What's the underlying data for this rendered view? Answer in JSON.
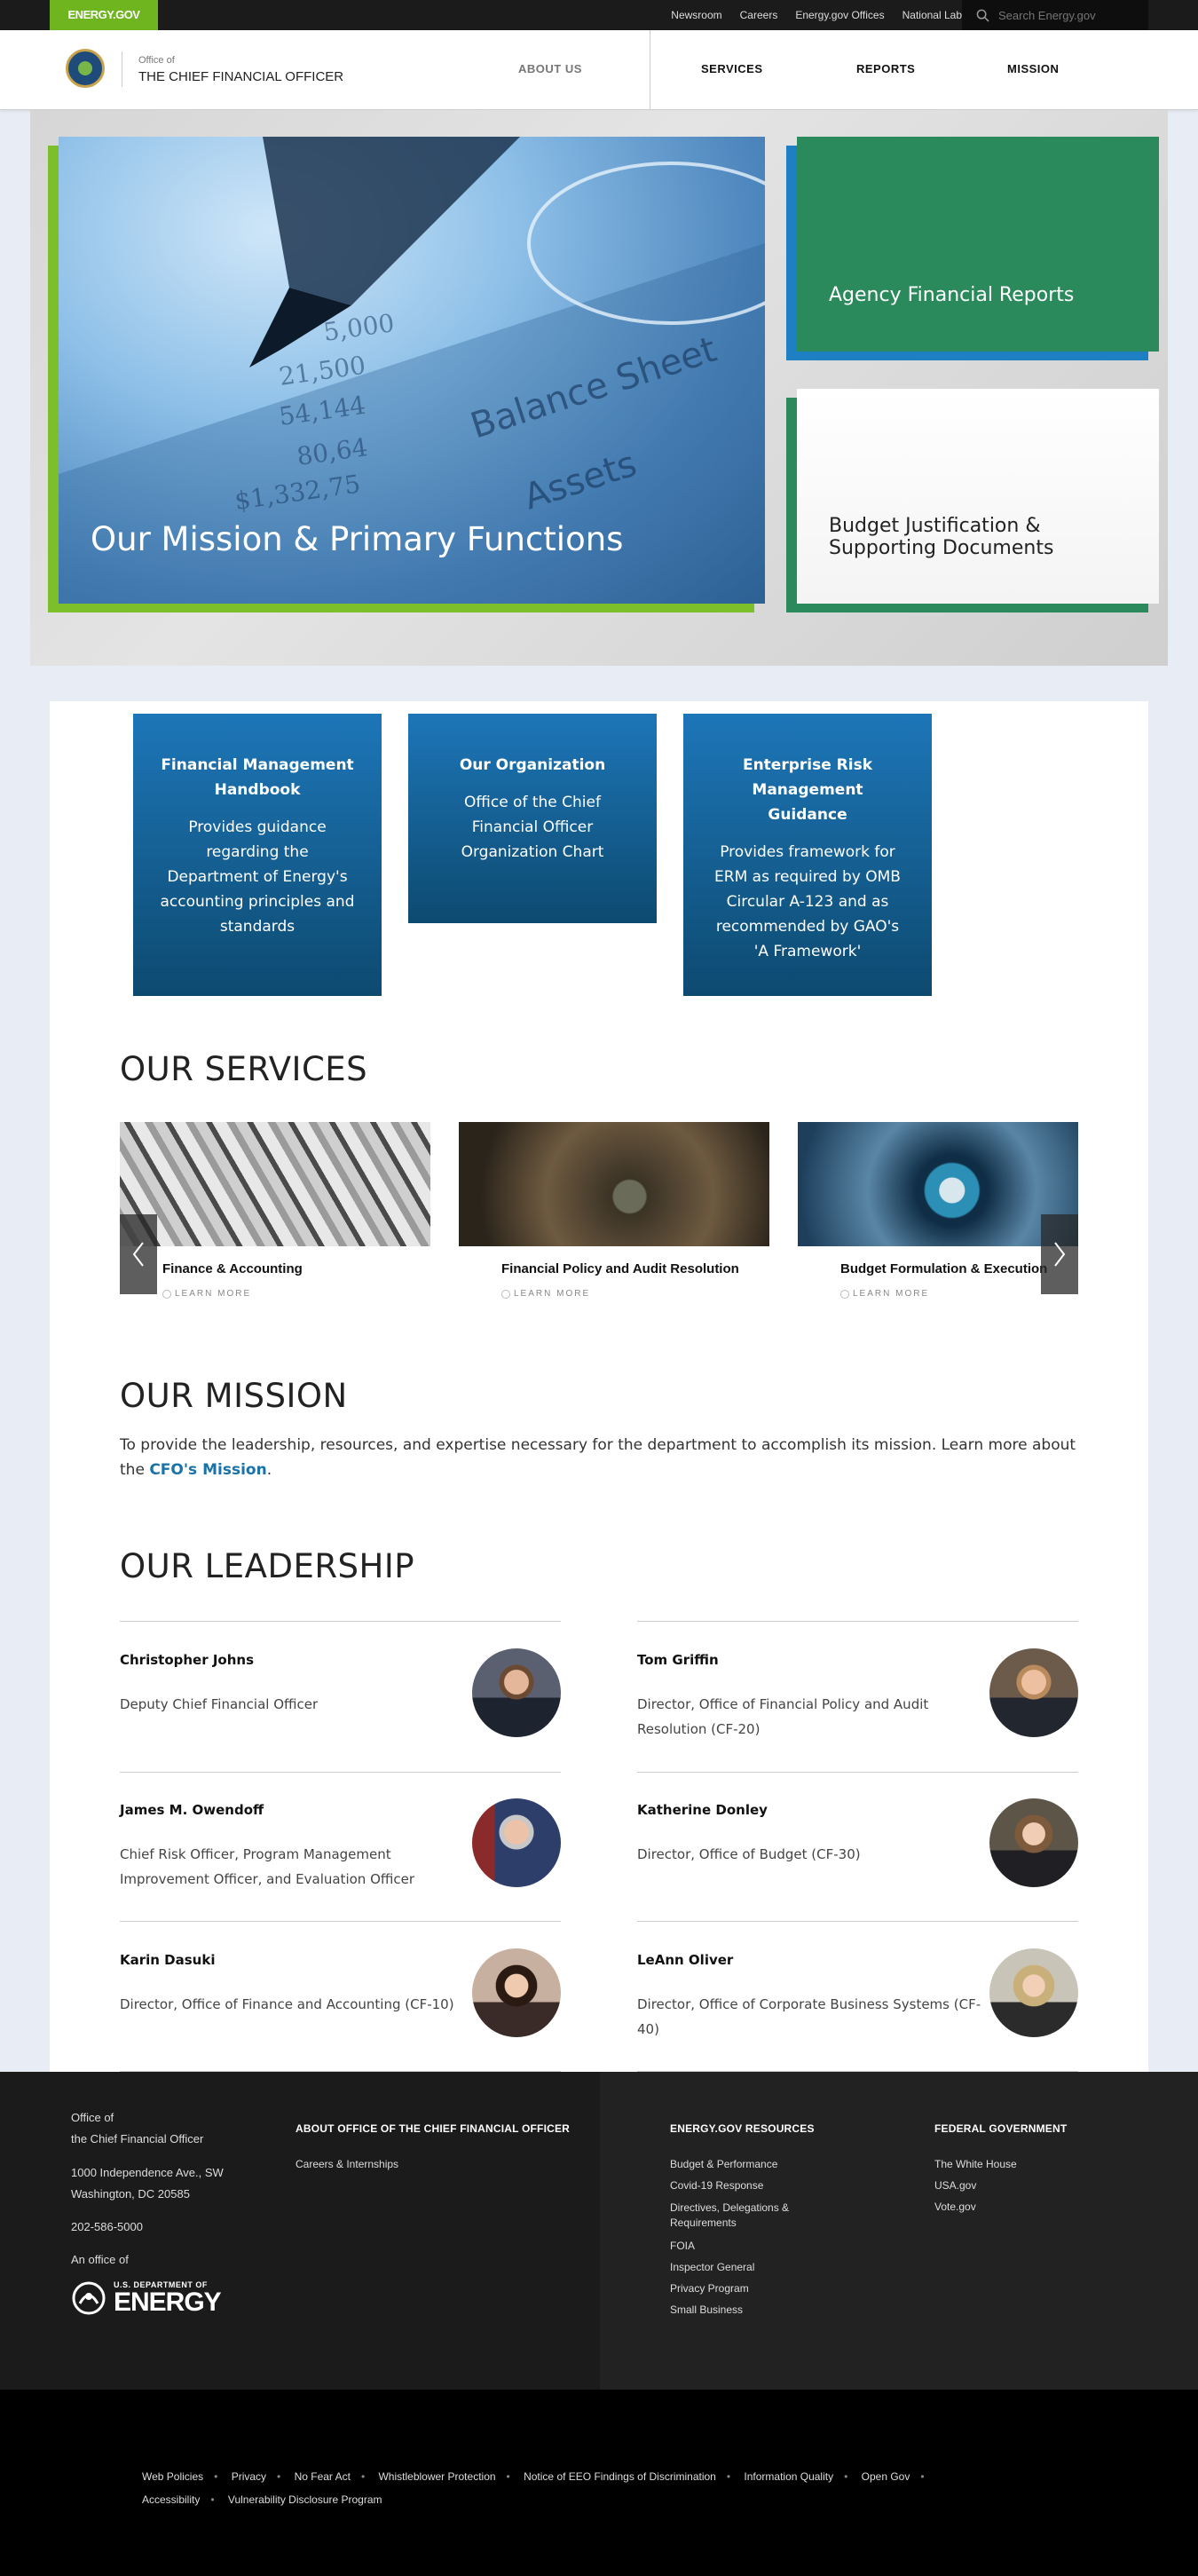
{
  "topbar": {
    "brand": "ENERGY.GOV",
    "links": [
      "Newsroom",
      "Careers",
      "Energy.gov Offices",
      "National Labs"
    ],
    "search_placeholder": "Search Energy.gov"
  },
  "header": {
    "office_of": "Office of",
    "office_name": "THE CHIEF FINANCIAL OFFICER",
    "nav": {
      "about": "ABOUT US",
      "services": "SERVICES",
      "reports": "REPORTS",
      "mission": "MISSION"
    }
  },
  "hero": {
    "main_title": "Our Mission & Primary Functions",
    "card_a": "Agency Financial Reports",
    "card_b": "Budget Justification & Supporting Documents"
  },
  "quick_cards": [
    {
      "title": "Financial Management Handbook",
      "text": "Provides guidance regarding the Department of Energy's accounting principles and standards"
    },
    {
      "title": "Our Organization",
      "text": "Office of the Chief Financial Officer Organization Chart"
    },
    {
      "title": "Enterprise Risk Management Guidance",
      "text": "Provides framework for ERM as required by OMB Circular A-123 and as recommended by GAO's 'A Framework'"
    }
  ],
  "services": {
    "heading": "OUR SERVICES",
    "learn_more": "LEARN MORE",
    "items": [
      {
        "title": "Finance & Accounting"
      },
      {
        "title": "Financial Policy and Audit Resolution"
      },
      {
        "title": "Budget Formulation & Execution"
      }
    ]
  },
  "mission": {
    "heading": "OUR MISSION",
    "text": "To provide the leadership, resources, and expertise necessary for the department to accomplish its mission. Learn more about the",
    "link": "CFO's Mission",
    "link_suffix": "."
  },
  "leadership": {
    "heading": "OUR LEADERSHIP",
    "people": [
      {
        "name": "Christopher Johns",
        "title": "Deputy Chief Financial Officer"
      },
      {
        "name": "Tom Griffin",
        "title": "Director, Office of Financial Policy and Audit Resolution (CF-20)"
      },
      {
        "name": "James M. Owendoff",
        "title": "Chief Risk Officer, Program Management Improvement Officer, and Evaluation Officer"
      },
      {
        "name": "Katherine Donley",
        "title": "Director, Office of Budget (CF-30)"
      },
      {
        "name": "Karin Dasuki",
        "title": "Director, Office of Finance and Accounting (CF-10)"
      },
      {
        "name": "LeAnn Oliver",
        "title": "Director, Office of Corporate Business Systems (CF-40)"
      }
    ]
  },
  "footer": {
    "office_line1": "Office of",
    "office_line2": "the Chief Financial Officer",
    "address1": "1000 Independence Ave., SW",
    "address2": "Washington, DC 20585",
    "phone": "202-586-5000",
    "an_office_of": "An office of",
    "doe_small": "U.S. DEPARTMENT OF",
    "doe_big": "ENERGY",
    "col_about": {
      "heading": "ABOUT OFFICE OF THE CHIEF FINANCIAL OFFICER",
      "links": [
        "Careers & Internships"
      ]
    },
    "col_resources": {
      "heading": "ENERGY.GOV RESOURCES",
      "links": [
        "Budget & Performance",
        "Covid-19 Response",
        "Directives, Delegations & Requirements",
        "FOIA",
        "Inspector General",
        "Privacy Program",
        "Small Business"
      ]
    },
    "col_federal": {
      "heading": "FEDERAL GOVERNMENT",
      "links": [
        "The White House",
        "USA.gov",
        "Vote.gov"
      ]
    },
    "bottom_links": [
      "Web Policies",
      "Privacy",
      "No Fear Act",
      "Whistleblower Protection",
      "Notice of EEO Findings of Discrimination",
      "Information Quality",
      "Open Gov",
      "Accessibility",
      "Vulnerability Disclosure Program"
    ]
  }
}
